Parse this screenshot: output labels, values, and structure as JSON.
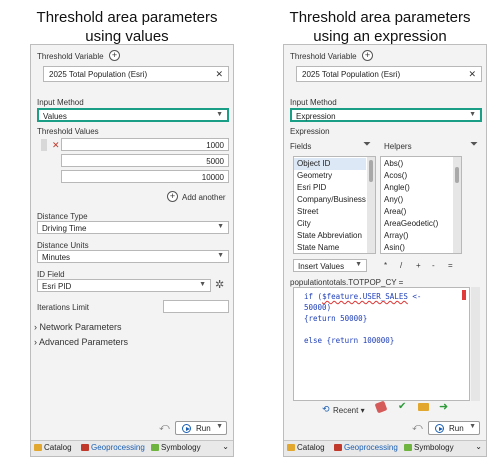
{
  "left": {
    "caption_line1": "Threshold area parameters",
    "caption_line2": "using values",
    "threshold_variable_label": "Threshold Variable",
    "threshold_variable_value": "2025 Total Population (Esri)",
    "input_method_label": "Input Method",
    "input_method_value": "Values",
    "threshold_values_label": "Threshold Values",
    "threshold_values": [
      "1000",
      "5000",
      "10000"
    ],
    "add_another_label": "Add another",
    "distance_type_label": "Distance Type",
    "distance_type_value": "Driving Time",
    "distance_units_label": "Distance Units",
    "distance_units_value": "Minutes",
    "id_field_label": "ID Field",
    "id_field_value": "Esri PID",
    "iterations_label": "Iterations Limit",
    "network_params_label": "Network Parameters",
    "advanced_params_label": "Advanced Parameters",
    "run_label": "Run"
  },
  "right": {
    "caption_line1": "Threshold area parameters",
    "caption_line2": "using an expression",
    "threshold_variable_label": "Threshold Variable",
    "threshold_variable_value": "2025 Total Population (Esri)",
    "input_method_label": "Input Method",
    "input_method_value": "Expression",
    "expression_label": "Expression",
    "fields_label": "Fields",
    "helpers_label": "Helpers",
    "fields": [
      "Object ID",
      "Geometry",
      "Esri PID",
      "Company/Business",
      "Street",
      "City",
      "State Abbreviation",
      "State Name"
    ],
    "helpers": [
      "Abs()",
      "Acos()",
      "Angle()",
      "Any()",
      "Area()",
      "AreaGeodetic()",
      "Array()",
      "Asin()"
    ],
    "insert_values_label": "Insert Values",
    "operators": [
      "*",
      "/",
      "+",
      "-",
      "="
    ],
    "expression_target": "populationtotals.TOTPOP_CY =",
    "code": {
      "l1_a": "if (",
      "l1_b": "$feature.USER_SALES",
      "l1_c": " <-",
      "l2": "50000)",
      "l3": "{return 50000}",
      "l4": "else {return 100000}"
    },
    "recent_label": "Recent",
    "run_label": "Run"
  },
  "tabs": [
    "Catalog",
    "Geoprocessing",
    "Symbology"
  ],
  "colors": {
    "highlight": "#1a9e86",
    "accent": "#1a5fb4"
  }
}
